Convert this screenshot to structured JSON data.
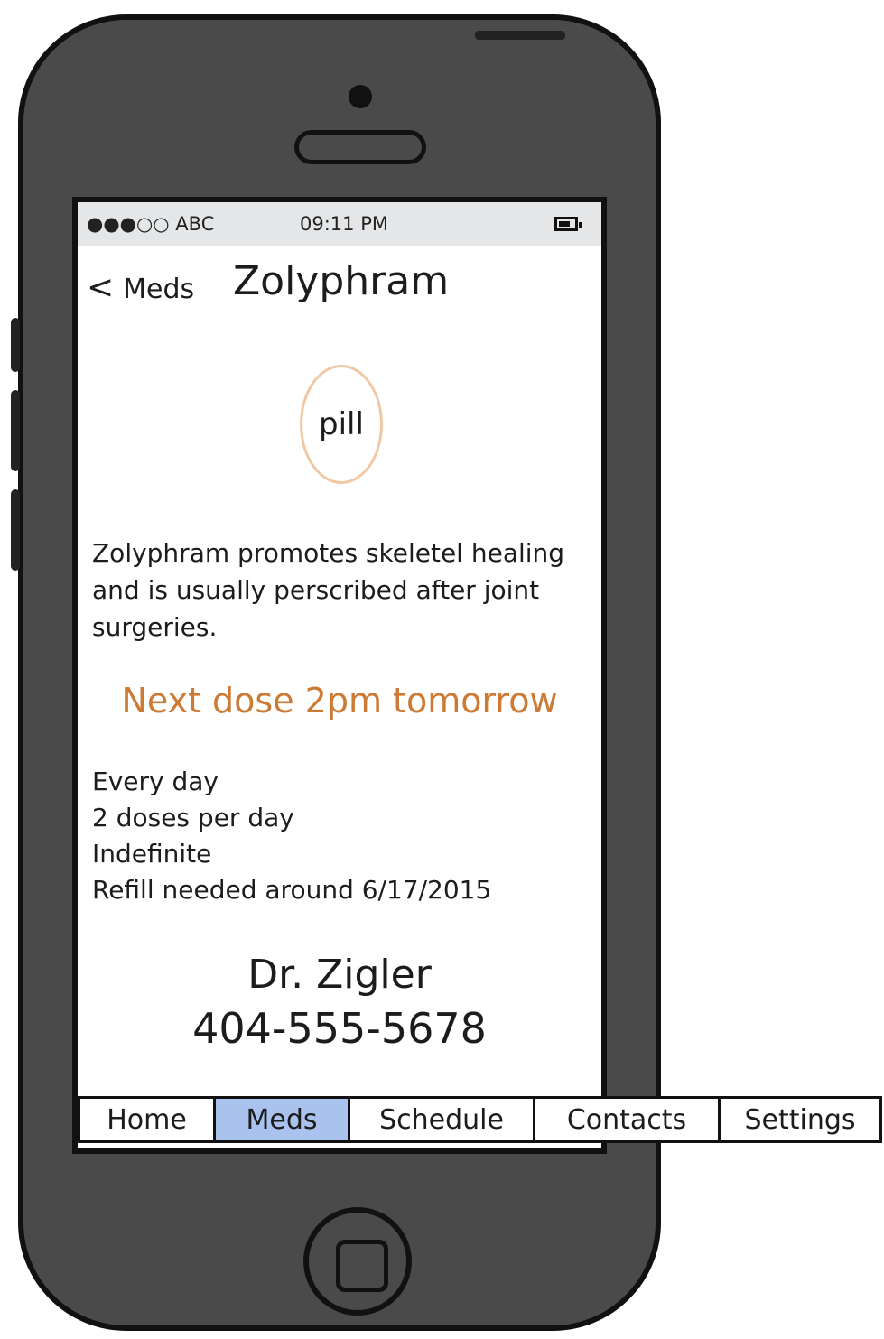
{
  "status_bar": {
    "carrier": "●●●○○ ABC",
    "time": "09:11 PM"
  },
  "nav": {
    "back_label": "Meds",
    "back_icon": "chevron-left-icon",
    "title": "Zolyphram"
  },
  "pill_label": "pill",
  "description": "Zolyphram promotes skeletel healing and is usually perscribed after joint surgeries.",
  "next_dose": "Next dose 2pm tomorrow",
  "details": [
    "Every day",
    "2 doses per day",
    "Indefinite",
    "Refill needed around 6/17/2015"
  ],
  "doctor": {
    "name": "Dr. Zigler",
    "phone": "404-555-5678"
  },
  "tabs": [
    {
      "label": "Home",
      "active": false
    },
    {
      "label": "Meds",
      "active": true
    },
    {
      "label": "Schedule",
      "active": false
    },
    {
      "label": "Contacts",
      "active": false
    },
    {
      "label": "Settings",
      "active": false
    }
  ],
  "colors": {
    "accent": "#cd7a34",
    "tab_active": "#a9c3ee",
    "pill_outline": "#f0c9a4",
    "device": "#4a4a4a"
  }
}
